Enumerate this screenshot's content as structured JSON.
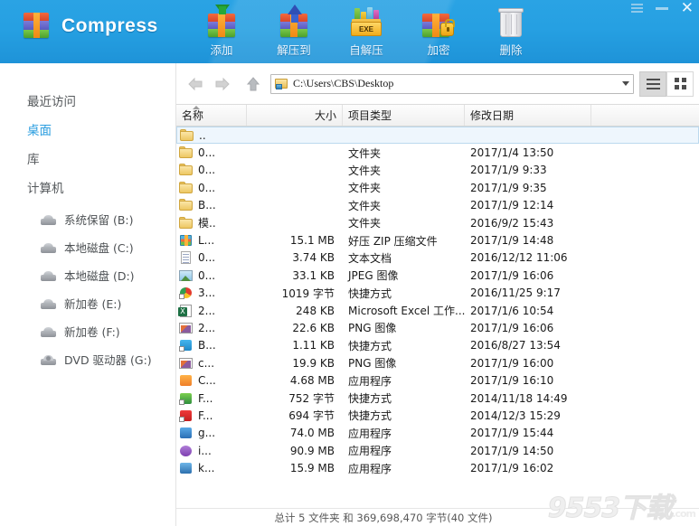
{
  "app": {
    "brand_title": "Compress",
    "brand_icon": "rar-archive-icon"
  },
  "window_controls": {
    "menu": "menu-icon",
    "minimize": "minimize-icon",
    "close": "close-icon"
  },
  "toolbar": {
    "buttons": [
      {
        "label": "添加",
        "icon": "add-to-archive-icon"
      },
      {
        "label": "解压到",
        "icon": "extract-to-icon"
      },
      {
        "label": "自解压",
        "icon": "self-extract-exe-icon"
      },
      {
        "label": "加密",
        "icon": "encrypt-lock-icon"
      },
      {
        "label": "删除",
        "icon": "delete-trash-icon"
      }
    ],
    "exe_label": "EXE"
  },
  "sidebar": {
    "places": [
      {
        "label": "最近访问",
        "selected": false
      },
      {
        "label": "桌面",
        "selected": true
      },
      {
        "label": "库",
        "selected": false
      },
      {
        "label": "计算机",
        "selected": false
      }
    ],
    "drives": [
      {
        "label": "系统保留 (B:)",
        "icon": "drive-icon"
      },
      {
        "label": "本地磁盘 (C:)",
        "icon": "drive-icon"
      },
      {
        "label": "本地磁盘 (D:)",
        "icon": "drive-icon"
      },
      {
        "label": "新加卷 (E:)",
        "icon": "drive-icon"
      },
      {
        "label": "新加卷 (F:)",
        "icon": "drive-icon"
      },
      {
        "label": "DVD 驱动器 (G:)",
        "icon": "dvd-drive-icon"
      }
    ]
  },
  "addressbar": {
    "back_icon": "back-arrow-icon",
    "forward_icon": "forward-arrow-icon",
    "up_icon": "up-arrow-icon",
    "path": "C:\\Users\\CBS\\Desktop",
    "folder_icon": "folder-icon",
    "dropdown_icon": "chevron-down-icon",
    "view_list_icon": "list-view-icon",
    "view_grid_icon": "grid-view-icon",
    "view_active": "list"
  },
  "columns": [
    {
      "key": "name",
      "label": "名称",
      "sorted": true
    },
    {
      "key": "size",
      "label": "大小",
      "sorted": false
    },
    {
      "key": "type",
      "label": "项目类型",
      "sorted": false
    },
    {
      "key": "date",
      "label": "修改日期",
      "sorted": false
    }
  ],
  "files": [
    {
      "icon": "folder",
      "name": "..",
      "size": "",
      "type": "",
      "date": "",
      "selected": true
    },
    {
      "icon": "folder",
      "name": "0...",
      "size": "",
      "type": "文件夹",
      "date": "2017/1/4 13:50",
      "selected": false
    },
    {
      "icon": "folder",
      "name": "0...",
      "size": "",
      "type": "文件夹",
      "date": "2017/1/9 9:33",
      "selected": false
    },
    {
      "icon": "folder",
      "name": "0...",
      "size": "",
      "type": "文件夹",
      "date": "2017/1/9 9:35",
      "selected": false
    },
    {
      "icon": "folder",
      "name": "B...",
      "size": "",
      "type": "文件夹",
      "date": "2017/1/9 12:14",
      "selected": false
    },
    {
      "icon": "folder",
      "name": "模..",
      "size": "",
      "type": "文件夹",
      "date": "2016/9/2 15:43",
      "selected": false
    },
    {
      "icon": "rar",
      "name": "L...",
      "size": "15.1 MB",
      "type": "好压 ZIP 压缩文件",
      "date": "2017/1/9 14:48",
      "selected": false
    },
    {
      "icon": "txt",
      "name": "0...",
      "size": "3.74 KB",
      "type": "文本文档",
      "date": "2016/12/12 11:06",
      "selected": false
    },
    {
      "icon": "jpg",
      "name": "0...",
      "size": "33.1 KB",
      "type": "JPEG 图像",
      "date": "2017/1/9 16:06",
      "selected": false
    },
    {
      "icon": "lnk-chrome",
      "name": "3...",
      "size": "1019 字节",
      "type": "快捷方式",
      "date": "2016/11/25 9:17",
      "selected": false
    },
    {
      "icon": "xls",
      "name": "2...",
      "size": "248 KB",
      "type": "Microsoft Excel 工作...",
      "date": "2017/1/6 10:54",
      "selected": false
    },
    {
      "icon": "png",
      "name": "2...",
      "size": "22.6 KB",
      "type": "PNG 图像",
      "date": "2017/1/9 16:06",
      "selected": false
    },
    {
      "icon": "lnk-blue",
      "name": "B...",
      "size": "1.11 KB",
      "type": "快捷方式",
      "date": "2016/8/27 13:54",
      "selected": false
    },
    {
      "icon": "png",
      "name": "c...",
      "size": "19.9 KB",
      "type": "PNG 图像",
      "date": "2017/1/9 16:00",
      "selected": false
    },
    {
      "icon": "app-orange",
      "name": "C...",
      "size": "4.68 MB",
      "type": "应用程序",
      "date": "2017/1/9 16:10",
      "selected": false
    },
    {
      "icon": "lnk-green",
      "name": "F...",
      "size": "752 字节",
      "type": "快捷方式",
      "date": "2014/11/18 14:49",
      "selected": false
    },
    {
      "icon": "lnk-red",
      "name": "F...",
      "size": "694 字节",
      "type": "快捷方式",
      "date": "2014/12/3 15:29",
      "selected": false
    },
    {
      "icon": "app-blue",
      "name": "g...",
      "size": "74.0 MB",
      "type": "应用程序",
      "date": "2017/1/9 15:44",
      "selected": false
    },
    {
      "icon": "app-purple",
      "name": "i...",
      "size": "90.9 MB",
      "type": "应用程序",
      "date": "2017/1/9 14:50",
      "selected": false
    },
    {
      "icon": "app-blue2",
      "name": "k...",
      "size": "15.9 MB",
      "type": "应用程序",
      "date": "2017/1/9 16:02",
      "selected": false
    }
  ],
  "status": {
    "text": "总计 5 文件夹 和  369,698,470 字节(40 文件)"
  },
  "watermark": {
    "text": "9553下载",
    "suffix": ".com"
  },
  "colors": {
    "titlebar": "#26a0e2",
    "accent": "#2e9fe0",
    "selection": "#eef6fd",
    "selection_border": "#bcd9ee"
  }
}
